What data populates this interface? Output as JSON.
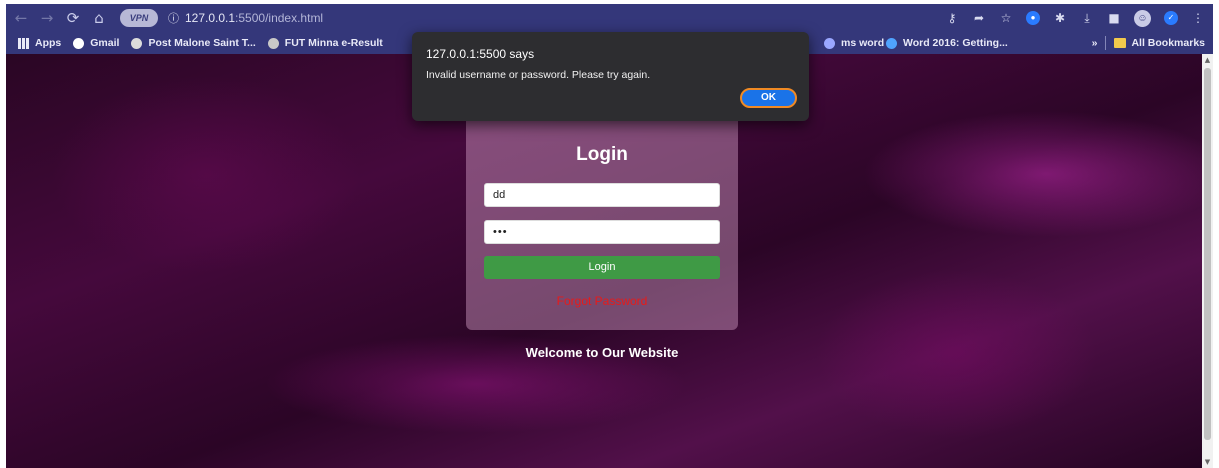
{
  "browser": {
    "url_host": "127.0.0.1",
    "url_rest": ":5500/index.html",
    "vpn_label": "VPN",
    "nav": {
      "back": "←",
      "forward": "→",
      "reload": "⟳",
      "home": "⌂"
    },
    "info": "ⓘ",
    "toolbar_icons": [
      "key-icon",
      "share-icon",
      "star-icon",
      "extension-icon",
      "puzzle-icon",
      "download-icon",
      "sidepanel-icon",
      "profile-icon",
      "check-icon",
      "menu-icon"
    ]
  },
  "bookmarks": {
    "items": [
      {
        "label": "Apps",
        "icon": "apps-grid-icon"
      },
      {
        "label": "Gmail",
        "icon": "google-icon",
        "color": "#ffffff"
      },
      {
        "label": "Post Malone Saint T...",
        "icon": "cloud-icon",
        "color": "#dcdcdc"
      },
      {
        "label": "FUT Minna e-Result",
        "icon": "fut-icon",
        "color": "#c8c8c8"
      }
    ],
    "right_items": [
      {
        "label": "ms word",
        "icon": "doc-icon",
        "color": "#9aa7ff"
      },
      {
        "label": "Word 2016: Getting...",
        "icon": "word-icon",
        "color": "#4fa3ff"
      }
    ],
    "more": "»",
    "all_bookmarks": "All Bookmarks"
  },
  "login": {
    "title": "Login",
    "username_value": "dd",
    "password_value": "•••",
    "button_label": "Login",
    "forgot_label": "Forgot Password"
  },
  "welcome": "Welcome to Our Website",
  "alert": {
    "title": "127.0.0.1:5500 says",
    "message": "Invalid username or password. Please try again.",
    "ok_label": "OK"
  },
  "colors": {
    "frame": "#2c2f6a",
    "login_button": "#3f9a45",
    "forgot_link": "#e81a1a",
    "ok_button": "#1a73e8",
    "ok_focus_ring": "#f08a24"
  }
}
